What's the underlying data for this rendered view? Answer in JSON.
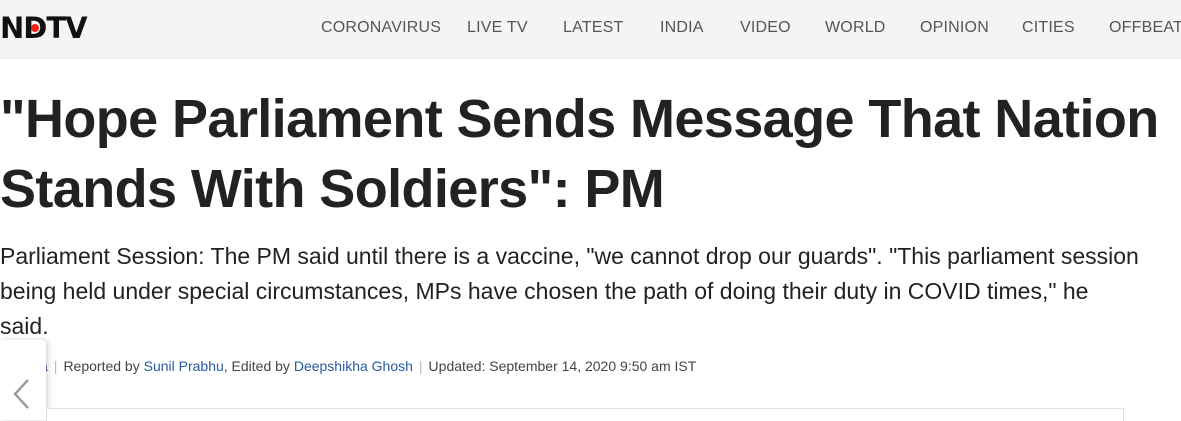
{
  "header": {
    "logo": "NDTV",
    "nav": [
      "CORONAVIRUS",
      "LIVE TV",
      "LATEST",
      "INDIA",
      "VIDEO",
      "WORLD",
      "OPINION",
      "CITIES",
      "OFFBEAT"
    ]
  },
  "article": {
    "headline": "\"Hope Parliament Sends Message That Nation Stands With Soldiers\": PM",
    "summary": "Parliament Session: The PM said until there is a vaccine, \"we cannot drop our guards\". \"This parliament session being held under special circumstances, MPs have chosen the path of doing their duty in COVID times,\" he said.",
    "byline": {
      "category_fragment": "a",
      "reported_prefix": "Reported by ",
      "reporter": "Sunil Prabhu",
      "edited_prefix": ", Edited by ",
      "editor": "Deepshikha Ghosh",
      "updated": "Updated: September 14, 2020 9:50 am IST"
    }
  },
  "icons": {
    "side_tab": "chevron-left-icon"
  },
  "colors": {
    "logo_dot": "#e8261c",
    "link": "#2a5aa0"
  }
}
